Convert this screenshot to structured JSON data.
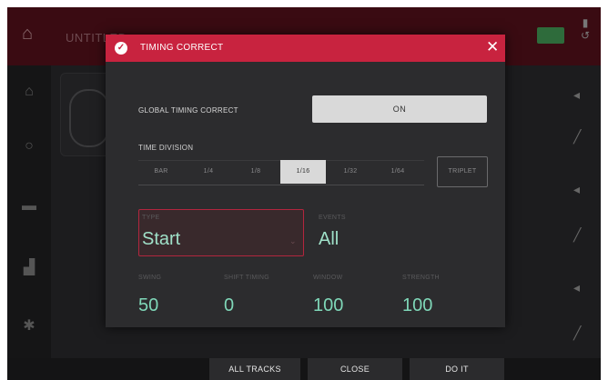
{
  "background": {
    "app_title": "UNTITLED"
  },
  "modal": {
    "title": "TIMING CORRECT",
    "global_label": "GLOBAL TIMING CORRECT",
    "global_value": "ON",
    "division_label": "TIME DIVISION",
    "divisions": [
      "BAR",
      "1/4",
      "1/8",
      "1/16",
      "1/32",
      "1/64"
    ],
    "selected_division": "1/16",
    "triplet_label": "TRIPLET",
    "type_label": "TYPE",
    "type_value": "Start",
    "events_label": "EVENTS",
    "events_value": "All",
    "params": [
      {
        "label": "SWING",
        "value": "50"
      },
      {
        "label": "SHIFT TIMING",
        "value": "0"
      },
      {
        "label": "WINDOW",
        "value": "100"
      },
      {
        "label": "STRENGTH",
        "value": "100"
      }
    ]
  },
  "bottom": {
    "all_tracks": "ALL TRACKS",
    "close": "CLOSE",
    "do_it": "DO IT"
  },
  "colors": {
    "header": "#c8233f",
    "value_text": "#9fe0c8"
  },
  "icons": [
    "home-icon",
    "check-icon",
    "close-icon",
    "chevron-down-icon",
    "pencil-icon",
    "speaker-icon"
  ]
}
